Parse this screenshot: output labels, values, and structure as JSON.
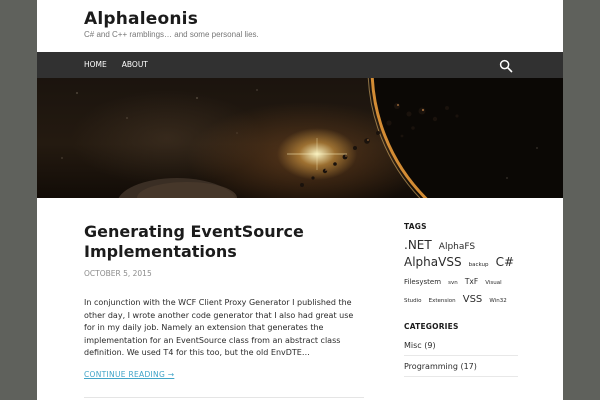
{
  "site": {
    "title": "Alphaleonis",
    "description": "C# and C++ ramblings… and some personal lies."
  },
  "nav": {
    "items": [
      "Home",
      "About"
    ],
    "search_icon": "search-icon"
  },
  "hero": {
    "image": "space-planet-asteroids-banner"
  },
  "post": {
    "title": "Generating EventSource Implementations",
    "date": "October 5, 2015",
    "summary": "In conjunction with the WCF Client Proxy Generator I published the other day, I wrote another code generator that I also had great use for in my daily job. Namely an extension that generates the implementation for an EventSource class from an abstract class definition. We used T4 for this too, but the old EnvDTE…",
    "continue_label": "Continue reading →"
  },
  "sidebar": {
    "tags_title": "Tags",
    "tags": [
      {
        "name": ".NET",
        "size": 12
      },
      {
        "name": "AlphaFS",
        "size": 9
      },
      {
        "name": "AlphaVSS",
        "size": 12
      },
      {
        "name": "backup",
        "size": 5.5
      },
      {
        "name": "C#",
        "size": 12
      },
      {
        "name": "Filesystem",
        "size": 7
      },
      {
        "name": "svn",
        "size": 5.5
      },
      {
        "name": "TxF",
        "size": 7.5
      },
      {
        "name": "Visual Studio",
        "size": 5.5
      },
      {
        "name": "Extension",
        "size": 5.5
      },
      {
        "name": "VSS",
        "size": 10
      },
      {
        "name": "Win32",
        "size": 5.5
      }
    ],
    "categories_title": "Categories",
    "categories": [
      {
        "name": "Misc",
        "count": "(9)"
      },
      {
        "name": "Programming",
        "count": "(17)"
      }
    ]
  },
  "colors": {
    "background": "#5f615c",
    "navbar": "#313131",
    "link_accent": "#41a4c8"
  }
}
